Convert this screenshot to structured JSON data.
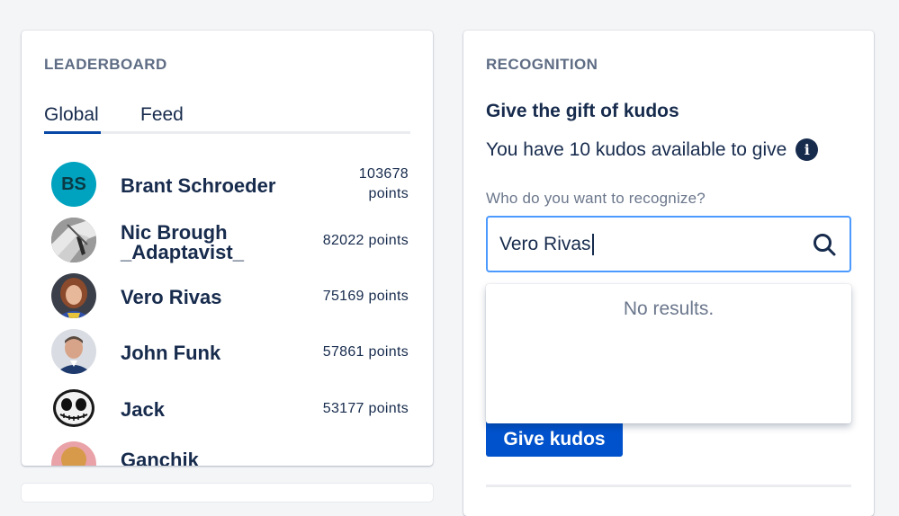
{
  "leaderboard": {
    "title": "LEADERBOARD",
    "tabs": [
      {
        "label": "Global",
        "active": true
      },
      {
        "label": "Feed",
        "active": false
      }
    ],
    "entries": [
      {
        "name_lines": [
          "Brant Schroeder"
        ],
        "points_lines": [
          "103678",
          "points"
        ],
        "avatar": "initials",
        "initials": "BS"
      },
      {
        "name_lines": [
          "Nic Brough",
          "_Adaptavist_"
        ],
        "points_lines": [
          "82022 points"
        ],
        "avatar": "photo-bw-icon"
      },
      {
        "name_lines": [
          "Vero Rivas"
        ],
        "points_lines": [
          "75169 points"
        ],
        "avatar": "photo-woman-icon"
      },
      {
        "name_lines": [
          "John Funk"
        ],
        "points_lines": [
          "57861 points"
        ],
        "avatar": "photo-man-icon"
      },
      {
        "name_lines": [
          "Jack"
        ],
        "points_lines": [
          "53177 points"
        ],
        "avatar": "skull-face-icon"
      },
      {
        "name_lines": [
          "Ganchik"
        ],
        "points_lines": [
          ""
        ],
        "avatar": "photo-partial-icon"
      }
    ]
  },
  "recognition": {
    "title": "RECOGNITION",
    "subtitle": "Give the gift of kudos",
    "available_text": "You have 10 kudos available to give",
    "info_glyph": "i",
    "field_label": "Who do you want to recognize?",
    "search_value": "Vero Rivas",
    "dropdown_message": "No results.",
    "button_label": "Give kudos"
  },
  "colors": {
    "background": "#f4f5f7",
    "accent": "#0052cc",
    "focus_border": "#4c9aff",
    "tab_active": "#0747a6",
    "avatar_initials_bg": "#00a3bf"
  }
}
